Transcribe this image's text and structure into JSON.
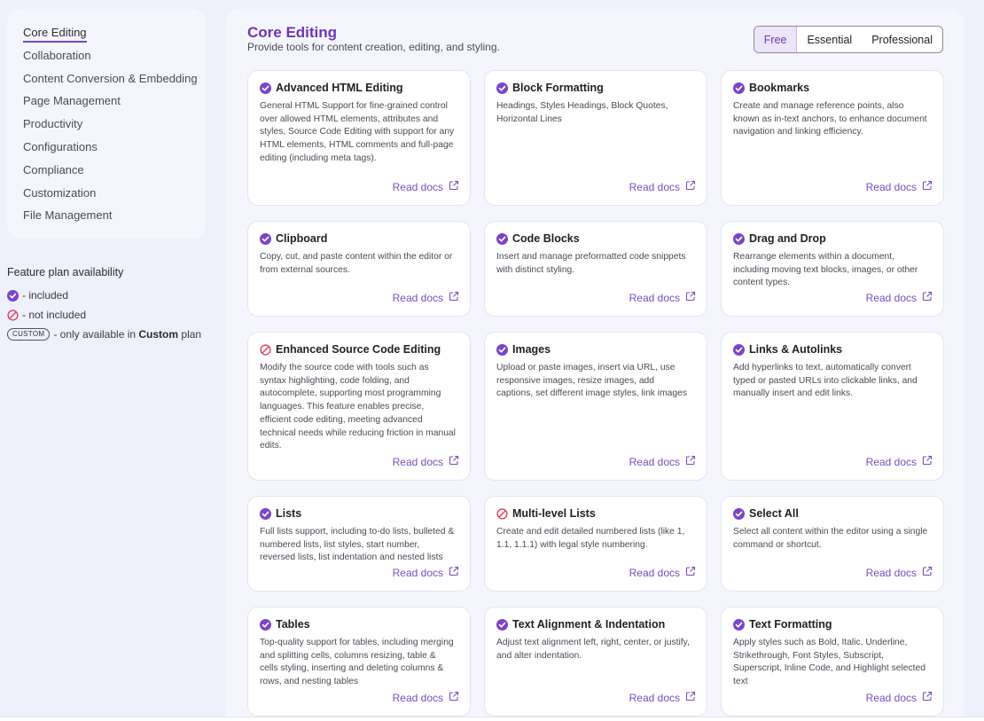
{
  "sidebar": {
    "items": [
      {
        "label": "Core Editing",
        "active": true
      },
      {
        "label": "Collaboration"
      },
      {
        "label": "Content Conversion & Embedding"
      },
      {
        "label": "Page Management"
      },
      {
        "label": "Productivity"
      },
      {
        "label": "Configurations"
      },
      {
        "label": "Compliance"
      },
      {
        "label": "Customization"
      },
      {
        "label": "File Management"
      }
    ]
  },
  "legend": {
    "title": "Feature plan availability",
    "included": "- included",
    "not_included": "- not included",
    "custom_badge": "CUSTOM",
    "custom_text_pre": "- only available in",
    "custom_text_bold": "Custom",
    "custom_text_post": "plan"
  },
  "main": {
    "title": "Core Editing",
    "subtitle": "Provide tools for content creation, editing, and styling."
  },
  "plans": {
    "free": "Free",
    "essential": "Essential",
    "professional": "Professional",
    "selected": "Free"
  },
  "colors": {
    "accent": "#6d35b8",
    "check": "#7a45c8",
    "blocked": "#e0405a"
  },
  "read_docs_label": "Read docs",
  "cards": [
    {
      "title": "Advanced HTML Editing",
      "status": "included",
      "desc": "General HTML Support for fine-grained control over allowed HTML elements, attributes and styles, Source Code Editing with support for any HTML elements, HTML comments and full-page editing (including meta tags)."
    },
    {
      "title": "Block Formatting",
      "status": "included",
      "desc": "Headings, Styles Headings, Block Quotes, Horizontal Lines"
    },
    {
      "title": "Bookmarks",
      "status": "included",
      "desc": "Create and manage reference points, also known as in-text anchors, to enhance document navigation and linking efficiency."
    },
    {
      "title": "Clipboard",
      "status": "included",
      "desc": "Copy, cut, and paste content within the editor or from external sources."
    },
    {
      "title": "Code Blocks",
      "status": "included",
      "desc": "Insert and manage preformatted code snippets with distinct styling."
    },
    {
      "title": "Drag and Drop",
      "status": "included",
      "desc": "Rearrange elements within a document, including moving text blocks, images, or other content types."
    },
    {
      "title": "Enhanced Source Code Editing",
      "status": "not_included",
      "desc": "Modify the source code with tools such as syntax highlighting, code folding, and autocomplete, supporting most programming languages. This feature enables precise, efficient code editing, meeting advanced technical needs while reducing friction in manual edits."
    },
    {
      "title": "Images",
      "status": "included",
      "desc": "Upload or paste images, insert via URL, use responsive images, resize images, add captions, set different image styles, link images"
    },
    {
      "title": "Links & Autolinks",
      "status": "included",
      "desc": "Add hyperlinks to text, automatically convert typed or pasted URLs into clickable links, and manually insert and edit links."
    },
    {
      "title": "Lists",
      "status": "included",
      "desc": "Full lists support, including to-do lists, bulleted & numbered lists, list styles, start number, reversed lists, list indentation and nested lists"
    },
    {
      "title": "Multi-level Lists",
      "status": "not_included",
      "desc": "Create and edit detailed numbered lists (like 1, 1.1, 1.1.1) with legal style numbering."
    },
    {
      "title": "Select All",
      "status": "included",
      "desc": "Select all content within the editor using a single command or shortcut."
    },
    {
      "title": "Tables",
      "status": "included",
      "desc": "Top-quality support for tables, including merging and splitting cells, columns resizing, table & cells styling, inserting and deleting columns & rows, and nesting tables"
    },
    {
      "title": "Text Alignment & Indentation",
      "status": "included",
      "desc": "Adjust text alignment left, right, center, or justify, and alter indentation."
    },
    {
      "title": "Text Formatting",
      "status": "included",
      "desc": "Apply styles such as Bold, Italic, Underline, Strikethrough, Font Styles, Subscript, Superscript, Inline Code, and Highlight selected text"
    }
  ]
}
